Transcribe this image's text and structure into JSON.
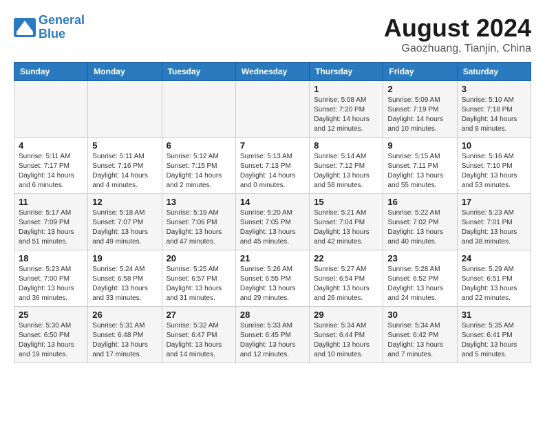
{
  "header": {
    "logo_line1": "General",
    "logo_line2": "Blue",
    "month_year": "August 2024",
    "location": "Gaozhuang, Tianjin, China"
  },
  "weekdays": [
    "Sunday",
    "Monday",
    "Tuesday",
    "Wednesday",
    "Thursday",
    "Friday",
    "Saturday"
  ],
  "weeks": [
    [
      {
        "day": "",
        "info": ""
      },
      {
        "day": "",
        "info": ""
      },
      {
        "day": "",
        "info": ""
      },
      {
        "day": "",
        "info": ""
      },
      {
        "day": "1",
        "info": "Sunrise: 5:08 AM\nSunset: 7:20 PM\nDaylight: 14 hours\nand 12 minutes."
      },
      {
        "day": "2",
        "info": "Sunrise: 5:09 AM\nSunset: 7:19 PM\nDaylight: 14 hours\nand 10 minutes."
      },
      {
        "day": "3",
        "info": "Sunrise: 5:10 AM\nSunset: 7:18 PM\nDaylight: 14 hours\nand 8 minutes."
      }
    ],
    [
      {
        "day": "4",
        "info": "Sunrise: 5:11 AM\nSunset: 7:17 PM\nDaylight: 14 hours\nand 6 minutes."
      },
      {
        "day": "5",
        "info": "Sunrise: 5:11 AM\nSunset: 7:16 PM\nDaylight: 14 hours\nand 4 minutes."
      },
      {
        "day": "6",
        "info": "Sunrise: 5:12 AM\nSunset: 7:15 PM\nDaylight: 14 hours\nand 2 minutes."
      },
      {
        "day": "7",
        "info": "Sunrise: 5:13 AM\nSunset: 7:13 PM\nDaylight: 14 hours\nand 0 minutes."
      },
      {
        "day": "8",
        "info": "Sunrise: 5:14 AM\nSunset: 7:12 PM\nDaylight: 13 hours\nand 58 minutes."
      },
      {
        "day": "9",
        "info": "Sunrise: 5:15 AM\nSunset: 7:11 PM\nDaylight: 13 hours\nand 55 minutes."
      },
      {
        "day": "10",
        "info": "Sunrise: 5:16 AM\nSunset: 7:10 PM\nDaylight: 13 hours\nand 53 minutes."
      }
    ],
    [
      {
        "day": "11",
        "info": "Sunrise: 5:17 AM\nSunset: 7:09 PM\nDaylight: 13 hours\nand 51 minutes."
      },
      {
        "day": "12",
        "info": "Sunrise: 5:18 AM\nSunset: 7:07 PM\nDaylight: 13 hours\nand 49 minutes."
      },
      {
        "day": "13",
        "info": "Sunrise: 5:19 AM\nSunset: 7:06 PM\nDaylight: 13 hours\nand 47 minutes."
      },
      {
        "day": "14",
        "info": "Sunrise: 5:20 AM\nSunset: 7:05 PM\nDaylight: 13 hours\nand 45 minutes."
      },
      {
        "day": "15",
        "info": "Sunrise: 5:21 AM\nSunset: 7:04 PM\nDaylight: 13 hours\nand 42 minutes."
      },
      {
        "day": "16",
        "info": "Sunrise: 5:22 AM\nSunset: 7:02 PM\nDaylight: 13 hours\nand 40 minutes."
      },
      {
        "day": "17",
        "info": "Sunrise: 5:23 AM\nSunset: 7:01 PM\nDaylight: 13 hours\nand 38 minutes."
      }
    ],
    [
      {
        "day": "18",
        "info": "Sunrise: 5:23 AM\nSunset: 7:00 PM\nDaylight: 13 hours\nand 36 minutes."
      },
      {
        "day": "19",
        "info": "Sunrise: 5:24 AM\nSunset: 6:58 PM\nDaylight: 13 hours\nand 33 minutes."
      },
      {
        "day": "20",
        "info": "Sunrise: 5:25 AM\nSunset: 6:57 PM\nDaylight: 13 hours\nand 31 minutes."
      },
      {
        "day": "21",
        "info": "Sunrise: 5:26 AM\nSunset: 6:55 PM\nDaylight: 13 hours\nand 29 minutes."
      },
      {
        "day": "22",
        "info": "Sunrise: 5:27 AM\nSunset: 6:54 PM\nDaylight: 13 hours\nand 26 minutes."
      },
      {
        "day": "23",
        "info": "Sunrise: 5:28 AM\nSunset: 6:52 PM\nDaylight: 13 hours\nand 24 minutes."
      },
      {
        "day": "24",
        "info": "Sunrise: 5:29 AM\nSunset: 6:51 PM\nDaylight: 13 hours\nand 22 minutes."
      }
    ],
    [
      {
        "day": "25",
        "info": "Sunrise: 5:30 AM\nSunset: 6:50 PM\nDaylight: 13 hours\nand 19 minutes."
      },
      {
        "day": "26",
        "info": "Sunrise: 5:31 AM\nSunset: 6:48 PM\nDaylight: 13 hours\nand 17 minutes."
      },
      {
        "day": "27",
        "info": "Sunrise: 5:32 AM\nSunset: 6:47 PM\nDaylight: 13 hours\nand 14 minutes."
      },
      {
        "day": "28",
        "info": "Sunrise: 5:33 AM\nSunset: 6:45 PM\nDaylight: 13 hours\nand 12 minutes."
      },
      {
        "day": "29",
        "info": "Sunrise: 5:34 AM\nSunset: 6:44 PM\nDaylight: 13 hours\nand 10 minutes."
      },
      {
        "day": "30",
        "info": "Sunrise: 5:34 AM\nSunset: 6:42 PM\nDaylight: 13 hours\nand 7 minutes."
      },
      {
        "day": "31",
        "info": "Sunrise: 5:35 AM\nSunset: 6:41 PM\nDaylight: 13 hours\nand 5 minutes."
      }
    ]
  ]
}
